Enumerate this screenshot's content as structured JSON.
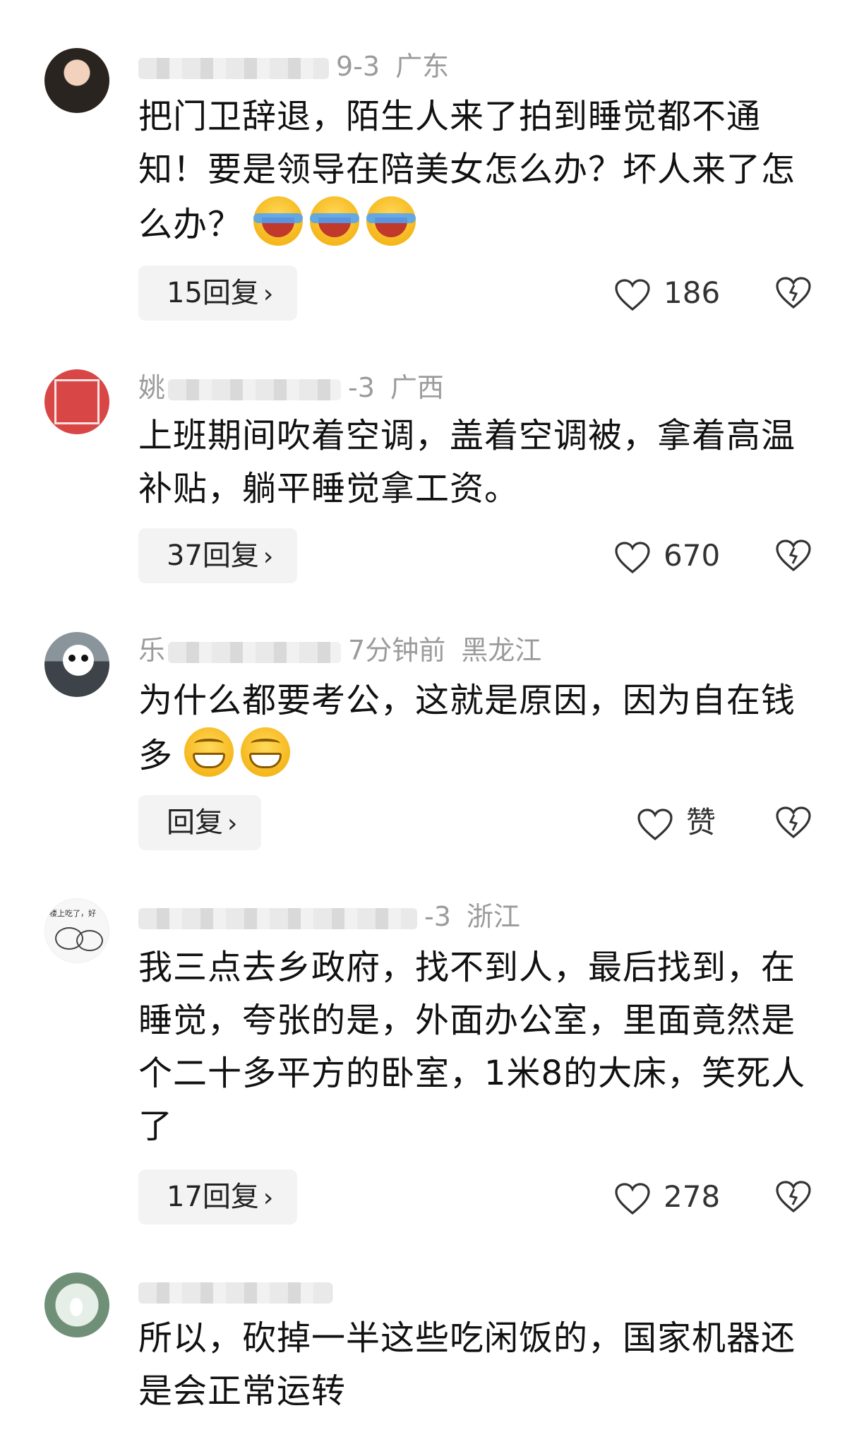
{
  "comments": [
    {
      "meta_time": "9-3",
      "meta_location": "广东",
      "text": "把门卫辞退，陌生人来了拍到睡觉都不通知！要是领导在陪美女怎么办？坏人来了怎么办？",
      "emoji": [
        "loudly-crying-face",
        "loudly-crying-face",
        "loudly-crying-face"
      ],
      "reply_label": "15回复",
      "like_label": "186"
    },
    {
      "meta_name_visible": "姚",
      "meta_time": "-3",
      "meta_location": "广西",
      "text": "上班期间吹着空调，盖着空调被，拿着高温补贴，躺平睡觉拿工资。",
      "emoji": [],
      "reply_label": "37回复",
      "like_label": "670"
    },
    {
      "meta_name_visible": "乐",
      "meta_time": "7分钟前",
      "meta_location": "黑龙江",
      "text": "为什么都要考公，这就是原因，因为自在钱多",
      "emoji": [
        "grinning-face",
        "grinning-face"
      ],
      "reply_label": "回复",
      "like_label": "赞"
    },
    {
      "meta_time": "-3",
      "meta_location": "浙江",
      "avatar_text": "楼上吃了，好",
      "text": "我三点去乡政府，找不到人，最后找到，在睡觉，夸张的是，外面办公室，里面竟然是个二十多平方的卧室，1米8的大床，笑死人了",
      "emoji": [],
      "reply_label": "17回复",
      "like_label": "278"
    },
    {
      "meta_time": "",
      "meta_location": "",
      "text": "所以，砍掉一半这些吃闲饭的，国家机器还是会正常运转",
      "emoji": []
    }
  ],
  "colors": {
    "meta": "#9b9b9b",
    "text": "#111111",
    "reply_bg": "#f3f3f3"
  },
  "icons": [
    "heart-icon",
    "broken-heart-icon",
    "chevron-right-icon"
  ]
}
